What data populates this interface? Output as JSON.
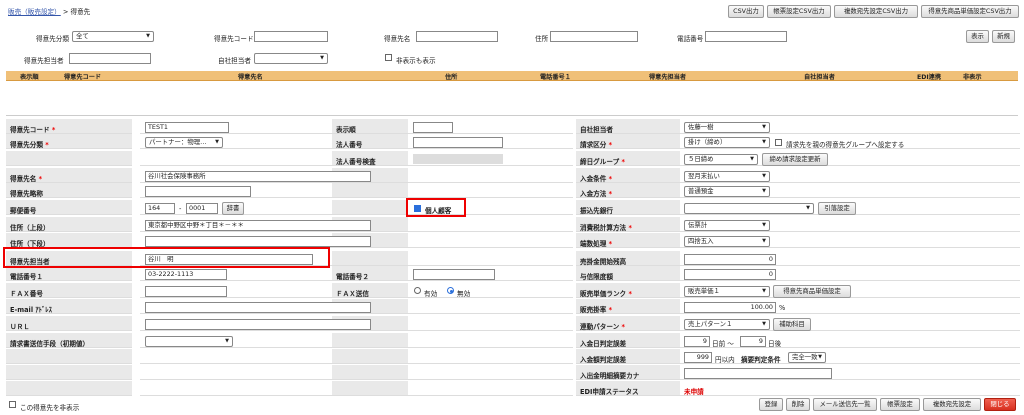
{
  "breadcrumb": {
    "parent": "販売（販売設定）",
    "sep": ">",
    "current": "得意先"
  },
  "top_buttons": [
    "CSV出力",
    "帳票設定CSV出力",
    "複数宛先設定CSV出力",
    "得意先商品単価設定CSV出力"
  ],
  "search": {
    "category_label": "得意先分類",
    "category_value": "全て",
    "code_label": "得意先コード",
    "code_value": "",
    "name_label": "得意先名",
    "name_value": "",
    "address_label": "住所",
    "address_value": "",
    "phone_label": "電話番号",
    "phone_value": "",
    "contact_label": "得意先担当者",
    "contact_value": "",
    "staff_label": "自社担当者",
    "staff_value": "",
    "hidden_label": "非表示も表示",
    "show_button": "表示",
    "new_button": "新規"
  },
  "table_headers": [
    "表示順",
    "得意先コード",
    "得意先名",
    "住所",
    "電話番号１",
    "得意先担当者",
    "自社担当者",
    "EDI連携",
    "非表示"
  ],
  "form": {
    "code_label": "得意先コード",
    "code_value": "TEST1",
    "category_label": "得意先分類",
    "category_value": "パートナー：物理…",
    "name_label": "得意先名",
    "name_value": "谷川社会保険事務所",
    "short_label": "得意先略称",
    "short_value": "",
    "postal_label": "郵便番号",
    "postal1": "164",
    "postal_dash": "-",
    "postal2": "0001",
    "dict_button": "辞書",
    "addr1_label": "住所（上段）",
    "addr1_value": "東京都中野区中野＊丁目＊－＊＊",
    "addr2_label": "住所（下段）",
    "addr2_value": "",
    "contact_label": "得意先担当者",
    "contact_value": "谷川　明",
    "tel1_label": "電話番号１",
    "tel1_value": "03-2222-1113",
    "fax_label": "ＦＡＸ番号",
    "fax_value": "",
    "email_label": "E-mail ｱﾄﾞﾚｽ",
    "email_value": "",
    "url_label": "ＵＲＬ",
    "url_value": "",
    "invoice_label": "請求書送信手段（初期値）",
    "invoice_value": "",
    "order_label": "表示順",
    "order_value": "",
    "corp_label": "法人番号",
    "corp_value": "",
    "corp_check_label": "法人番号検査",
    "individual_label": "個人顧客",
    "tel2_label": "電話番号２",
    "tel2_value": "",
    "faxsend_label": "ＦＡＸ送信",
    "faxsend_on": "有効",
    "faxsend_off": "無効",
    "staff_label": "自社担当者",
    "staff_value": "佐藤一樹",
    "billing_label": "請求区分",
    "billing_value": "掛け（締め）",
    "parent_group_label": "請求先を親の得意先グループへ設定する",
    "close_group_label": "締日グループ",
    "close_group_value": "５日締め",
    "close_update_button": "締め請求設定更新",
    "pay_cond_label": "入金条件",
    "pay_cond_value": "翌月末払い",
    "pay_method_label": "入金方法",
    "pay_method_value": "普通預金",
    "bank_label": "振込先銀行",
    "bank_value": "",
    "bank_button": "引落設定",
    "tax_calc_label": "消費税計算方法",
    "tax_calc_value": "伝票計",
    "fraction_label": "端数処理",
    "fraction_value": "四捨五入",
    "receivable_label": "売掛金開始残高",
    "receivable_value": "0",
    "credit_label": "与信限度額",
    "credit_value": "0",
    "rank_label": "販売単価ランク",
    "rank_value": "販売単価１",
    "rank_button": "得意先商品単価設定",
    "rate_label": "販売掛率",
    "rate_value": "100.00",
    "rate_unit": "%",
    "pattern_label": "連動パターン",
    "pattern_value": "売上パターン１",
    "pattern_button": "補助科目",
    "due_label": "入金日判定誤差",
    "due_before": "9",
    "due_before_unit": "日前 ～",
    "due_after": "9",
    "due_after_unit": "日後",
    "amount_label": "入金額判定誤差",
    "amount_value": "999",
    "amount_unit": "円以内",
    "summary_label": "摘要判定条件",
    "summary_value": "完全一致",
    "kana_label": "入出金明細摘要カナ",
    "kana_value": "",
    "edi_label": "EDI申請ステータス",
    "edi_value": "未申請",
    "hide_label": "この得意先を非表示"
  },
  "bottom_buttons": {
    "register": "登録",
    "delete": "削除",
    "mail_list": "メール送信先一覧",
    "report": "帳票設定",
    "multi_dest": "複数宛先設定",
    "close": "閉じる"
  }
}
